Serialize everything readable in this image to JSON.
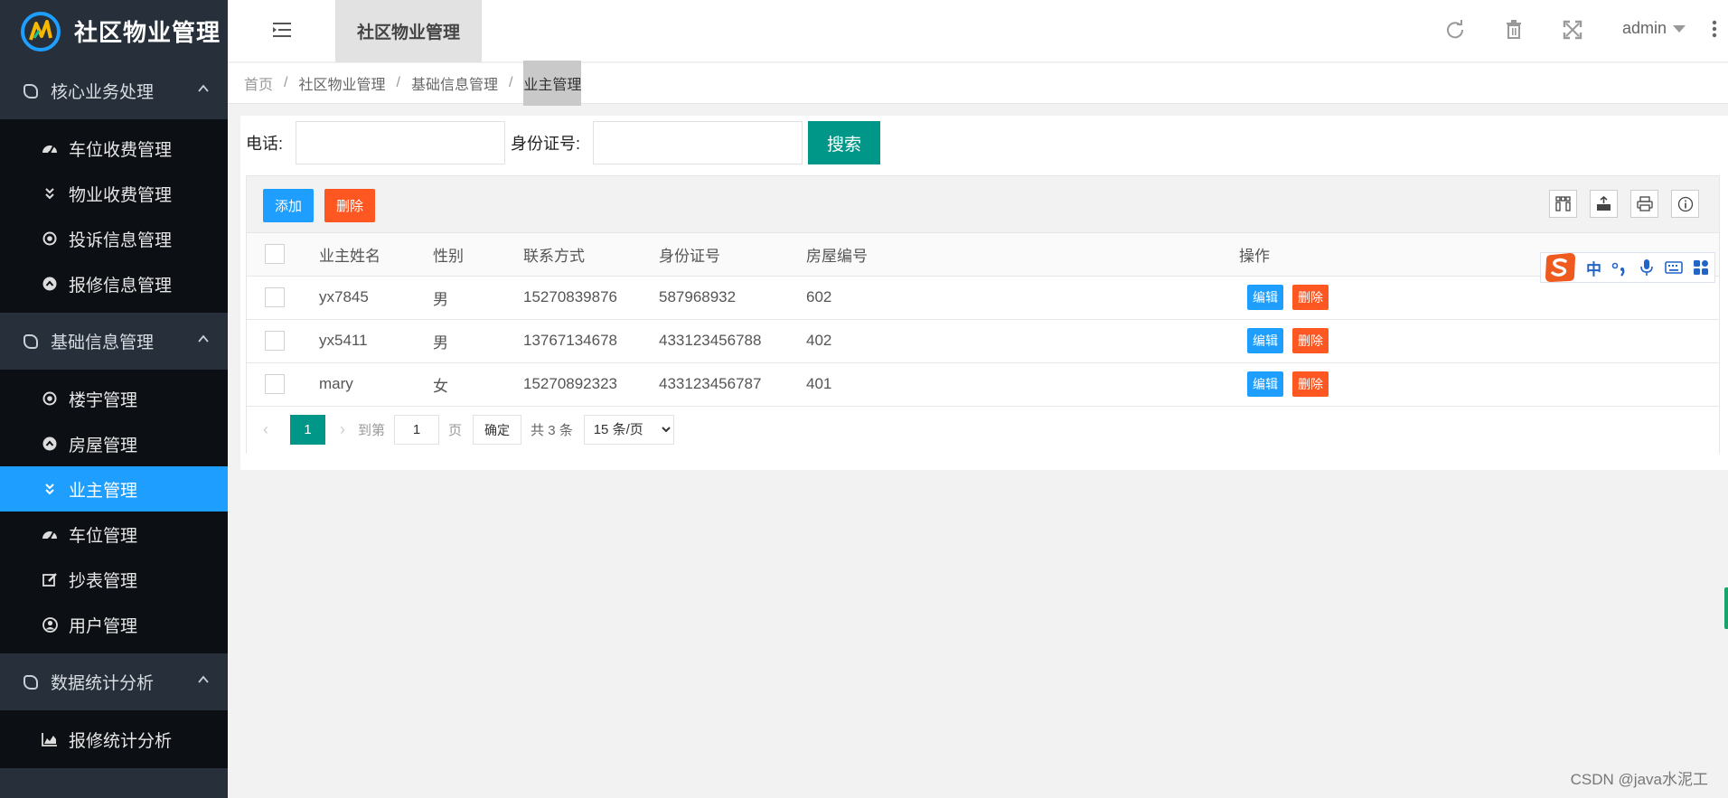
{
  "app": {
    "title": "社区物业管理"
  },
  "sidebar": {
    "groups": [
      {
        "label": "核心业务处理",
        "items": [
          {
            "label": "车位收费管理",
            "icon": "dashboard-icon"
          },
          {
            "label": "物业收费管理",
            "icon": "double-chevron-icon"
          },
          {
            "label": "投诉信息管理",
            "icon": "radio-circle-icon"
          },
          {
            "label": "报修信息管理",
            "icon": "up-circle-icon"
          }
        ]
      },
      {
        "label": "基础信息管理",
        "items": [
          {
            "label": "楼宇管理",
            "icon": "radio-circle-icon"
          },
          {
            "label": "房屋管理",
            "icon": "up-circle-icon"
          },
          {
            "label": "业主管理",
            "icon": "double-chevron-icon",
            "active": true
          },
          {
            "label": "车位管理",
            "icon": "dashboard-icon"
          },
          {
            "label": "抄表管理",
            "icon": "edit-icon"
          },
          {
            "label": "用户管理",
            "icon": "user-circle-icon"
          }
        ]
      },
      {
        "label": "数据统计分析",
        "items": [
          {
            "label": "报修统计分析",
            "icon": "area-chart-icon"
          }
        ]
      }
    ]
  },
  "header": {
    "active_tab": "社区物业管理",
    "user": "admin"
  },
  "breadcrumb": [
    "首页",
    "社区物业管理",
    "基础信息管理",
    "业主管理"
  ],
  "search": {
    "phone_label": "电话:",
    "phone_value": "",
    "idcard_label": "身份证号:",
    "idcard_value": "",
    "button": "搜索"
  },
  "toolbar": {
    "add": "添加",
    "delete": "删除"
  },
  "table": {
    "columns": [
      "业主姓名",
      "性别",
      "联系方式",
      "身份证号",
      "房屋编号",
      "操作"
    ],
    "rows": [
      {
        "name": "yx7845",
        "gender": "男",
        "phone": "15270839876",
        "idcard": "587968932",
        "house": "602"
      },
      {
        "name": "yx5411",
        "gender": "男",
        "phone": "13767134678",
        "idcard": "433123456788",
        "house": "402"
      },
      {
        "name": "mary",
        "gender": "女",
        "phone": "15270892323",
        "idcard": "433123456787",
        "house": "401"
      }
    ],
    "edit_label": "编辑",
    "delete_label": "删除"
  },
  "pager": {
    "current": "1",
    "goto_label": "到第",
    "goto_value": "1",
    "page_unit": "页",
    "confirm": "确定",
    "total": "共 3 条",
    "page_size": "15 条/页"
  },
  "ime": {
    "mode": "中"
  },
  "watermark": "CSDN @java水泥工",
  "colors": {
    "sidebar_bg": "#262f3a",
    "sidebar_sub_bg": "#0c0f13",
    "active_blue": "#1e9fff",
    "primary_green": "#009688",
    "danger_orange": "#ff5722"
  }
}
